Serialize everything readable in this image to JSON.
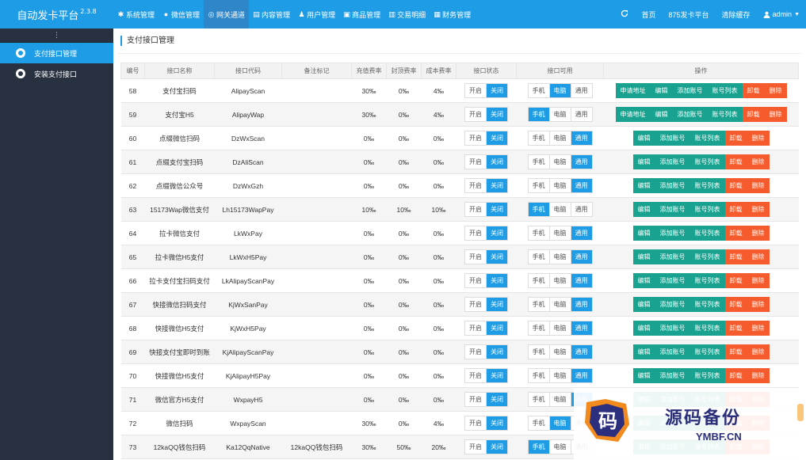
{
  "header": {
    "brand": "自动发卡平台",
    "version": "2.3.8",
    "nav": [
      {
        "label": "系统管理",
        "icon": "gear-icon"
      },
      {
        "label": "微信管理",
        "icon": "wechat-icon"
      },
      {
        "label": "网关通道",
        "icon": "globe-icon"
      },
      {
        "label": "内容管理",
        "icon": "document-icon"
      },
      {
        "label": "用户管理",
        "icon": "users-icon"
      },
      {
        "label": "商品管理",
        "icon": "bag-icon"
      },
      {
        "label": "交易明细",
        "icon": "bar-chart-icon"
      },
      {
        "label": "财务管理",
        "icon": "wallet-icon"
      }
    ],
    "active_nav": "网关通道",
    "right": {
      "refresh_icon": "refresh-icon",
      "home": "首页",
      "site": "875发卡平台",
      "clear_cache": "清除缓存",
      "user": "admin"
    }
  },
  "sidebar": {
    "toggle": "⋮",
    "items": [
      {
        "label": "支付接口管理",
        "active": true
      },
      {
        "label": "安装支付接口",
        "active": false
      }
    ]
  },
  "page": {
    "title": "支付接口管理"
  },
  "table": {
    "columns": [
      "编号",
      "接口名称",
      "接口代码",
      "备注标记",
      "充值费率",
      "封顶费率",
      "成本费率",
      "接口状态",
      "接口可用",
      "操作"
    ],
    "status_labels": [
      "开启",
      "关闭"
    ],
    "device_labels": [
      "手机",
      "电脑",
      "通用"
    ],
    "ops_labels": {
      "apply": "申请地址",
      "edit": "编辑",
      "add": "添加账号",
      "list": "账号列表",
      "uninstall": "卸载",
      "delete": "删除"
    },
    "rows": [
      {
        "id": "58",
        "name": "支付宝扫码",
        "code": "AlipayScan",
        "note": "",
        "rate": "30‰",
        "cap": "0‰",
        "cost": "4‰",
        "device": "电脑",
        "apply": true
      },
      {
        "id": "59",
        "name": "支付宝H5",
        "code": "AlipayWap",
        "note": "",
        "rate": "30‰",
        "cap": "0‰",
        "cost": "4‰",
        "device": "手机",
        "apply": true
      },
      {
        "id": "60",
        "name": "点缀微信扫码",
        "code": "DzWxScan",
        "note": "",
        "rate": "0‰",
        "cap": "0‰",
        "cost": "0‰",
        "device": "通用",
        "apply": false
      },
      {
        "id": "61",
        "name": "点缀支付宝扫码",
        "code": "DzAliScan",
        "note": "",
        "rate": "0‰",
        "cap": "0‰",
        "cost": "0‰",
        "device": "通用",
        "apply": false
      },
      {
        "id": "62",
        "name": "点缀微信公众号",
        "code": "DzWxGzh",
        "note": "",
        "rate": "0‰",
        "cap": "0‰",
        "cost": "0‰",
        "device": "通用",
        "apply": false
      },
      {
        "id": "63",
        "name": "15173Wap微信支付",
        "code": "Lh15173WapPay",
        "note": "",
        "rate": "10‰",
        "cap": "10‰",
        "cost": "10‰",
        "device": "手机",
        "apply": false
      },
      {
        "id": "64",
        "name": "拉卡微信支付",
        "code": "LkWxPay",
        "note": "",
        "rate": "0‰",
        "cap": "0‰",
        "cost": "0‰",
        "device": "通用",
        "apply": false
      },
      {
        "id": "65",
        "name": "拉卡微信H5支付",
        "code": "LkWxH5Pay",
        "note": "",
        "rate": "0‰",
        "cap": "0‰",
        "cost": "0‰",
        "device": "通用",
        "apply": false
      },
      {
        "id": "66",
        "name": "拉卡支付宝扫码支付",
        "code": "LkAlipayScanPay",
        "note": "",
        "rate": "0‰",
        "cap": "0‰",
        "cost": "0‰",
        "device": "通用",
        "apply": false
      },
      {
        "id": "67",
        "name": "快接微信扫码支付",
        "code": "KjWxSanPay",
        "note": "",
        "rate": "0‰",
        "cap": "0‰",
        "cost": "0‰",
        "device": "通用",
        "apply": false
      },
      {
        "id": "68",
        "name": "快接微信H5支付",
        "code": "KjWxH5Pay",
        "note": "",
        "rate": "0‰",
        "cap": "0‰",
        "cost": "0‰",
        "device": "通用",
        "apply": false
      },
      {
        "id": "69",
        "name": "快接支付宝即时到账",
        "code": "KjAlipayScanPay",
        "note": "",
        "rate": "0‰",
        "cap": "0‰",
        "cost": "0‰",
        "device": "通用",
        "apply": false
      },
      {
        "id": "70",
        "name": "快接微信H5支付",
        "code": "KjAlipayH5Pay",
        "note": "",
        "rate": "0‰",
        "cap": "0‰",
        "cost": "0‰",
        "device": "通用",
        "apply": false
      },
      {
        "id": "71",
        "name": "微信官方H5支付",
        "code": "WxpayH5",
        "note": "",
        "rate": "0‰",
        "cap": "0‰",
        "cost": "0‰",
        "device": "通用",
        "apply": false
      },
      {
        "id": "72",
        "name": "微信扫码",
        "code": "WxpayScan",
        "note": "",
        "rate": "30‰",
        "cap": "0‰",
        "cost": "4‰",
        "device": "电脑",
        "apply": false
      },
      {
        "id": "73",
        "name": "12kaQQ钱包扫码",
        "code": "Ka12QqNative",
        "note": "12kaQQ钱包扫码",
        "rate": "30‰",
        "cap": "50‰",
        "cost": "20‰",
        "device": "手机",
        "apply": false
      }
    ]
  },
  "watermark": {
    "logo_char": "码",
    "cn": "源码备份",
    "en": "YMBF.CN"
  },
  "colors": {
    "primary": "#1e9de6",
    "sidebar": "#283140",
    "teal": "#19a28f",
    "orange": "#f65b2e"
  }
}
